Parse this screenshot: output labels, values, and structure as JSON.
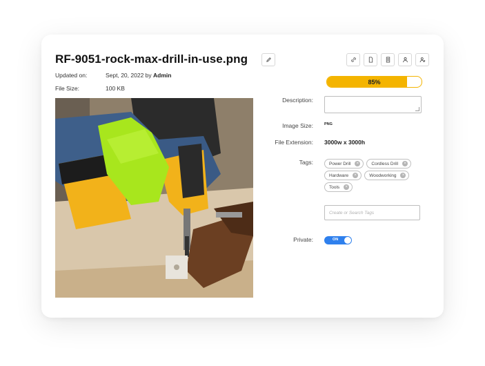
{
  "file": {
    "name": "RF-9051-rock-max-drill-in-use.png",
    "updated_label": "Updated on:",
    "updated_date": "Sept, 20, 2022 by",
    "updated_by": "Admin",
    "size_label": "File Size:",
    "size_value": "100 KB"
  },
  "toolbar": {
    "icons": [
      "link-icon",
      "file-icon",
      "document-icon",
      "user-icon",
      "user-add-icon"
    ]
  },
  "progress": {
    "value": 0.85,
    "label": "85%",
    "color": "#f4b400"
  },
  "fields": {
    "description_label": "Description:",
    "description_value": "",
    "image_size_label": "Image Size:",
    "image_size_value": "PNG",
    "extension_label": "File Extension:",
    "extension_value": "3000w x 3000h",
    "tags_label": "Tags:",
    "tags": [
      "Power Drill",
      "Cordless Drill",
      "Hardware",
      "Woodworking",
      "Tools"
    ],
    "tag_input_placeholder": "Create or Search Tags",
    "private_label": "Private:",
    "private_state": "ON"
  },
  "colors": {
    "accent": "#2f80ed",
    "progress": "#f4b400"
  }
}
